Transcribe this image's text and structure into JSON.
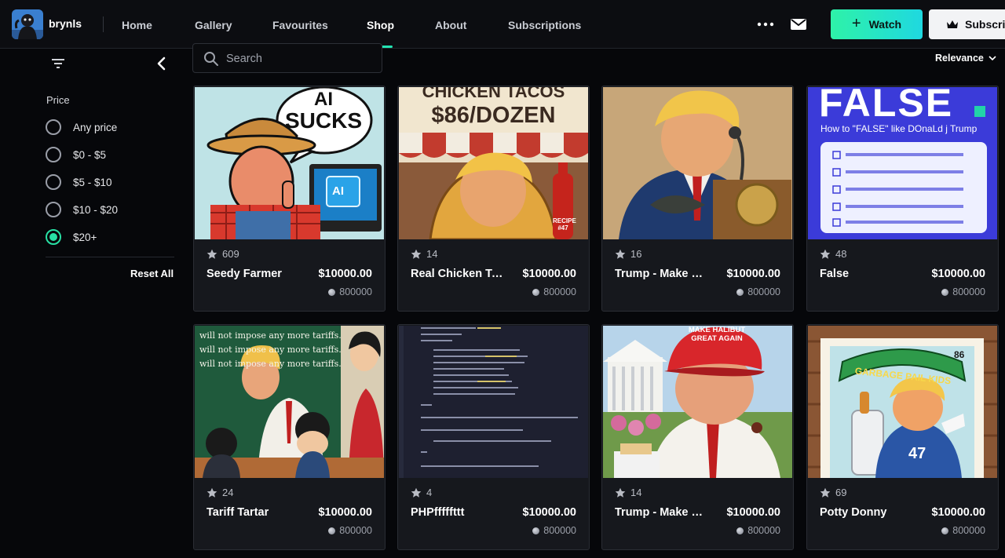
{
  "header": {
    "username": "brynls",
    "nav": [
      "Home",
      "Gallery",
      "Favourites",
      "Shop",
      "About",
      "Subscriptions"
    ],
    "active_nav": "Shop",
    "watch_label": "Watch",
    "subscribe_label": "Subscrib"
  },
  "sidebar": {
    "price_heading": "Price",
    "options": [
      "Any price",
      "$0 - $5",
      "$5 - $10",
      "$10 - $20",
      "$20+"
    ],
    "selected": "$20+",
    "reset_label": "Reset All"
  },
  "search": {
    "placeholder": "Search"
  },
  "sort": {
    "label": "Relevance"
  },
  "thumb_text": {
    "ai": "AI",
    "sucks": "SUCKS",
    "tacos_line1": "CHICKEN TACOS",
    "tacos_line2": "$86/DOZEN",
    "recipe": "RECIPE #47",
    "false_big": "FALSE",
    "false_sub": "How to \"FALSE\" like DOnaLd j Trump",
    "chalk": "will not impose any more tariffs.",
    "hat": "MAKE HALIBUT GREAT AGAIN",
    "gpk": "GARBAGE PAIL KIDS",
    "gpk_num": "86",
    "jersey": "47"
  },
  "colors": {
    "accent": "#24e3b2",
    "card_bg": "#16181d",
    "page_bg": "#06070a"
  },
  "cards": [
    {
      "likes": "609",
      "title": "Seedy Farmer",
      "price": "$10000.00",
      "points": "800000"
    },
    {
      "likes": "14",
      "title": "Real Chicken Tacos",
      "price": "$10000.00",
      "points": "800000"
    },
    {
      "likes": "16",
      "title": "Trump - Make Halibut Great Again",
      "price": "$10000.00",
      "points": "800000"
    },
    {
      "likes": "48",
      "title": "False",
      "price": "$10000.00",
      "points": "800000"
    },
    {
      "likes": "24",
      "title": "Tariff Tartar",
      "price": "$10000.00",
      "points": "800000"
    },
    {
      "likes": "4",
      "title": "PHPfffffttt",
      "price": "$10000.00",
      "points": "800000"
    },
    {
      "likes": "14",
      "title": "Trump - Make Halibut Great Again",
      "price": "$10000.00",
      "points": "800000"
    },
    {
      "likes": "69",
      "title": "Potty Donny",
      "price": "$10000.00",
      "points": "800000"
    }
  ]
}
